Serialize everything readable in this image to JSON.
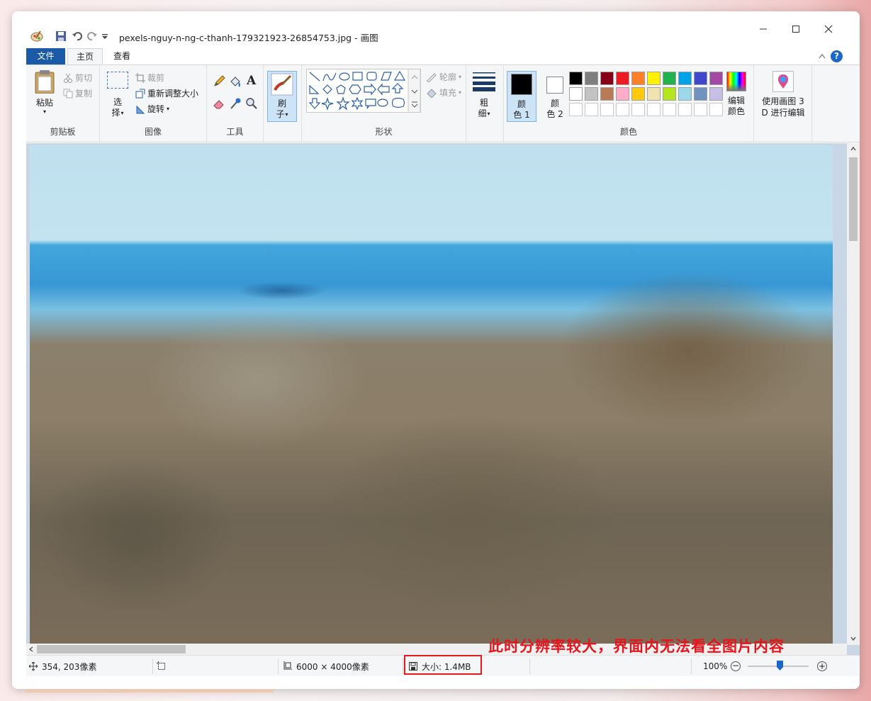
{
  "window": {
    "title": "pexels-nguy-n-ng-c-thanh-179321923-26854753.jpg - 画图"
  },
  "tabs": [
    "文件",
    "主页",
    "查看"
  ],
  "ribbon": {
    "clipboard": {
      "paste": "粘贴",
      "cut": "剪切",
      "copy": "复制",
      "label": "剪贴板"
    },
    "image": {
      "select_top": "选",
      "select_bottom": "择",
      "crop": "裁剪",
      "resize": "重新调整大小",
      "rotate": "旋转",
      "label": "图像"
    },
    "tools": {
      "label": "工具",
      "text_glyph": "A"
    },
    "brush": {
      "top": "刷",
      "bottom": "子"
    },
    "shapes": {
      "outline": "轮廓",
      "fill": "填充",
      "label": "形状"
    },
    "size": {
      "top": "粗",
      "bottom": "细"
    },
    "colors": {
      "color1_top": "颜",
      "color1_bottom": "色 1",
      "color2_top": "颜",
      "color2_bottom": "色 2",
      "edit_top": "编辑",
      "edit_bottom": "颜色",
      "label": "颜色",
      "palette_row1": [
        "#000000",
        "#7f7f7f",
        "#880015",
        "#ed1c24",
        "#ff7f27",
        "#fff200",
        "#22b14c",
        "#00a2e8",
        "#3f48cc",
        "#a349a4"
      ],
      "palette_row2": [
        "#ffffff",
        "#c3c3c3",
        "#b97a57",
        "#ffaec9",
        "#ffc90e",
        "#efe4b0",
        "#b5e61d",
        "#99d9ea",
        "#7092be",
        "#c8bfe7"
      ]
    },
    "paint3d": {
      "top": "使用画图 3",
      "bottom": "D 进行编辑"
    }
  },
  "status": {
    "coords": "354, 203像素",
    "dimensions": "6000 × 4000像素",
    "size": "大小: 1.4MB",
    "zoom": "100%"
  },
  "annotation": "此时分辨率较大，界面内无法看全图片内容"
}
